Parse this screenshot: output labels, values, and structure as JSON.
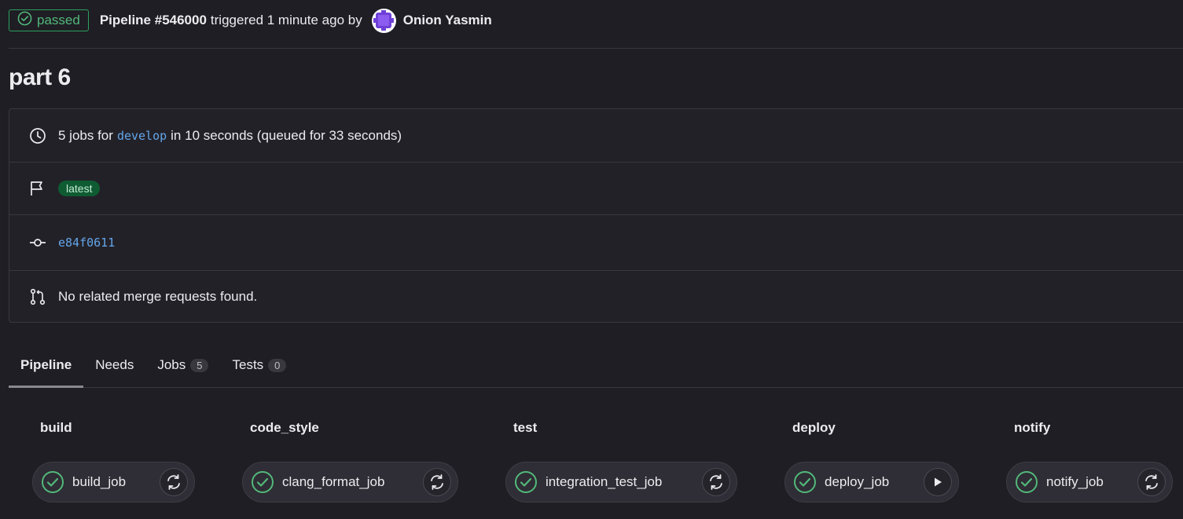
{
  "header": {
    "status": "passed",
    "pipeline_label": "Pipeline #546000",
    "trigger_text": "triggered 1 minute ago by",
    "author": "Onion Yasmin"
  },
  "title": "part 6",
  "info": {
    "jobs_prefix": "5 jobs for",
    "branch": "develop",
    "jobs_suffix": "in 10 seconds (queued for 33 seconds)",
    "badge": "latest",
    "commit": "e84f0611",
    "merge_requests": "No related merge requests found."
  },
  "tabs": [
    {
      "label": "Pipeline"
    },
    {
      "label": "Needs"
    },
    {
      "label": "Jobs",
      "count": "5"
    },
    {
      "label": "Tests",
      "count": "0"
    }
  ],
  "stages": [
    {
      "name": "build",
      "job": "build_job",
      "action": "retry-icon"
    },
    {
      "name": "code_style",
      "job": "clang_format_job",
      "action": "retry-icon"
    },
    {
      "name": "test",
      "job": "integration_test_job",
      "action": "retry-icon"
    },
    {
      "name": "deploy",
      "job": "deploy_job",
      "action": "play-icon"
    },
    {
      "name": "notify",
      "job": "notify_job",
      "action": "retry-icon"
    }
  ],
  "colors": {
    "success": "#52b87a",
    "link": "#63a6e9",
    "background": "#1f1e24"
  }
}
